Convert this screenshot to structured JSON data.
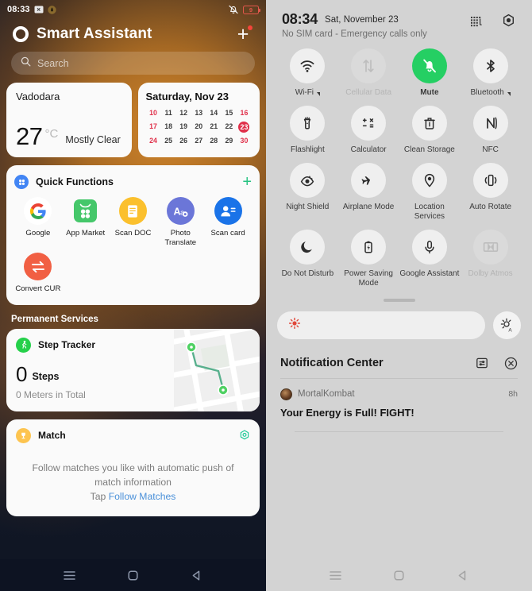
{
  "left": {
    "status_bar": {
      "time": "08:33",
      "icons": [
        "screenshot-icon",
        "app-notification-icon"
      ],
      "right_icons": [
        "mute-bell-icon"
      ],
      "battery_percent": "9"
    },
    "app_title": "Smart Assistant",
    "add_button_label": "+",
    "search": {
      "placeholder": "Search",
      "value": ""
    },
    "weather": {
      "city": "Vadodara",
      "temperature": "27",
      "unit": "°C",
      "condition": "Mostly Clear"
    },
    "calendar": {
      "title": "Saturday, Nov 23",
      "days": [
        {
          "n": "10",
          "weekend": true
        },
        {
          "n": "11"
        },
        {
          "n": "12"
        },
        {
          "n": "13"
        },
        {
          "n": "14"
        },
        {
          "n": "15"
        },
        {
          "n": "16",
          "weekend": true
        },
        {
          "n": "17",
          "weekend": true
        },
        {
          "n": "18"
        },
        {
          "n": "19"
        },
        {
          "n": "20"
        },
        {
          "n": "21"
        },
        {
          "n": "22"
        },
        {
          "n": "23",
          "today": true
        },
        {
          "n": "24",
          "weekend": true
        },
        {
          "n": "25"
        },
        {
          "n": "26"
        },
        {
          "n": "27"
        },
        {
          "n": "28"
        },
        {
          "n": "29"
        },
        {
          "n": "30",
          "weekend": true
        }
      ]
    },
    "quick_functions": {
      "title": "Quick Functions",
      "add_label": "+",
      "items": [
        {
          "label": "Google",
          "icon": "google-icon"
        },
        {
          "label": "App Market",
          "icon": "app-market-icon"
        },
        {
          "label": "Scan DOC",
          "icon": "scan-doc-icon"
        },
        {
          "label": "Photo Translate",
          "icon": "photo-translate-icon"
        },
        {
          "label": "Scan card",
          "icon": "scan-card-icon"
        },
        {
          "label": "Convert CUR",
          "icon": "convert-currency-icon"
        }
      ]
    },
    "permanent_services_title": "Permanent Services",
    "step_tracker": {
      "name": "Step Tracker",
      "steps_value": "0",
      "steps_unit": "Steps",
      "meters": "0  Meters in Total"
    },
    "match": {
      "name": "Match",
      "description_line1": "Follow matches you like with automatic push of",
      "description_line2": "match information",
      "cta_prefix": "Tap ",
      "cta_link": "Follow Matches"
    },
    "nav": [
      "recents-icon",
      "home-icon",
      "back-icon"
    ]
  },
  "right": {
    "header": {
      "time": "08:34",
      "date": "Sat, November 23",
      "sim_status": "No SIM card - Emergency calls only",
      "icons": [
        "edit-tiles-icon",
        "settings-icon"
      ]
    },
    "tiles": [
      {
        "label": "Wi-Fi",
        "icon": "wifi-icon",
        "state": "default",
        "expandable": true
      },
      {
        "label": "Cellular Data",
        "icon": "cellular-data-icon",
        "state": "disabled",
        "expandable": false
      },
      {
        "label": "Mute",
        "icon": "mute-icon",
        "state": "active",
        "expandable": false
      },
      {
        "label": "Bluetooth",
        "icon": "bluetooth-icon",
        "state": "default",
        "expandable": true
      },
      {
        "label": "Flashlight",
        "icon": "flashlight-icon",
        "state": "default",
        "expandable": false
      },
      {
        "label": "Calculator",
        "icon": "calculator-icon",
        "state": "default",
        "expandable": false
      },
      {
        "label": "Clean Storage",
        "icon": "trash-icon",
        "state": "default",
        "expandable": false
      },
      {
        "label": "NFC",
        "icon": "nfc-icon",
        "state": "default",
        "expandable": false
      },
      {
        "label": "Night Shield",
        "icon": "night-shield-icon",
        "state": "default",
        "expandable": false
      },
      {
        "label": "Airplane Mode",
        "icon": "airplane-icon",
        "state": "default",
        "expandable": false
      },
      {
        "label": "Location Services",
        "icon": "location-pin-icon",
        "state": "default",
        "expandable": false
      },
      {
        "label": "Auto Rotate",
        "icon": "auto-rotate-icon",
        "state": "default",
        "expandable": false
      },
      {
        "label": "Do Not Disturb",
        "icon": "moon-icon",
        "state": "default",
        "expandable": false
      },
      {
        "label": "Power Saving Mode",
        "icon": "battery-saver-icon",
        "state": "default",
        "expandable": false
      },
      {
        "label": "Google Assistant",
        "icon": "microphone-icon",
        "state": "default",
        "expandable": false
      },
      {
        "label": "Dolby Atmos",
        "icon": "dolby-atmos-icon",
        "state": "disabled",
        "expandable": false
      }
    ],
    "brightness": {
      "value_percent": 0,
      "icon": "brightness-low-icon",
      "auto_icon": "auto-brightness-icon"
    },
    "notification_center": {
      "title": "Notification Center",
      "actions": [
        "notification-settings-icon",
        "clear-all-icon"
      ],
      "items": [
        {
          "app": "MortalKombat",
          "time": "8h",
          "text": "Your Energy is Full! FIGHT!"
        }
      ]
    },
    "nav": [
      "recents-icon",
      "home-icon",
      "back-icon"
    ]
  },
  "colors": {
    "accent_green": "#25cf63",
    "accent_orange": "#d6882a",
    "today_red": "#e0304a",
    "link_blue": "#4a90d9"
  }
}
